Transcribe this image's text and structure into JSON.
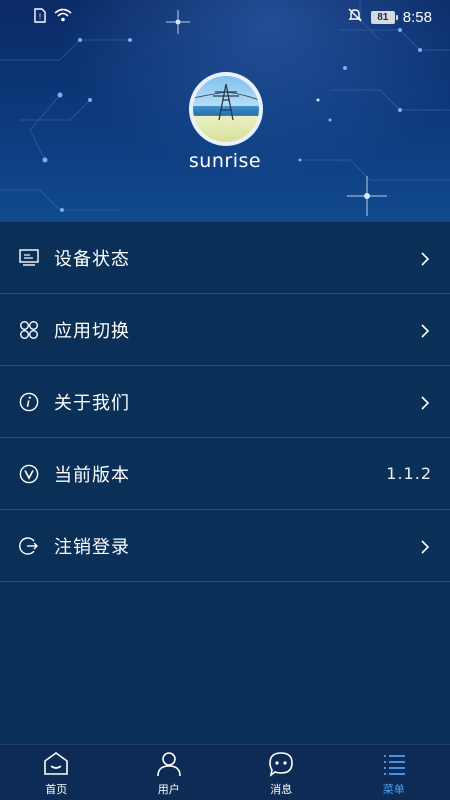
{
  "status_bar": {
    "battery_level": "81",
    "time": "8:58"
  },
  "profile": {
    "username": "sunrise"
  },
  "menu": {
    "items": [
      {
        "label": "设备状态",
        "icon": "device-status-icon",
        "value": "",
        "has_chevron": true
      },
      {
        "label": "应用切换",
        "icon": "app-switch-icon",
        "value": "",
        "has_chevron": true
      },
      {
        "label": "关于我们",
        "icon": "info-icon",
        "value": "",
        "has_chevron": true
      },
      {
        "label": "当前版本",
        "icon": "version-icon",
        "value": "1.1.2",
        "has_chevron": false
      },
      {
        "label": "注销登录",
        "icon": "logout-icon",
        "value": "",
        "has_chevron": true
      }
    ]
  },
  "bottom_nav": {
    "items": [
      {
        "label": "首页",
        "icon": "home-icon",
        "active": false
      },
      {
        "label": "用户",
        "icon": "user-icon",
        "active": false
      },
      {
        "label": "消息",
        "icon": "message-icon",
        "active": false
      },
      {
        "label": "菜单",
        "icon": "menu-list-icon",
        "active": true
      }
    ]
  },
  "colors": {
    "background": "#0a3058",
    "divider": "#2a4c74",
    "active_tab": "#4fa0f0",
    "text": "#ffffff"
  }
}
